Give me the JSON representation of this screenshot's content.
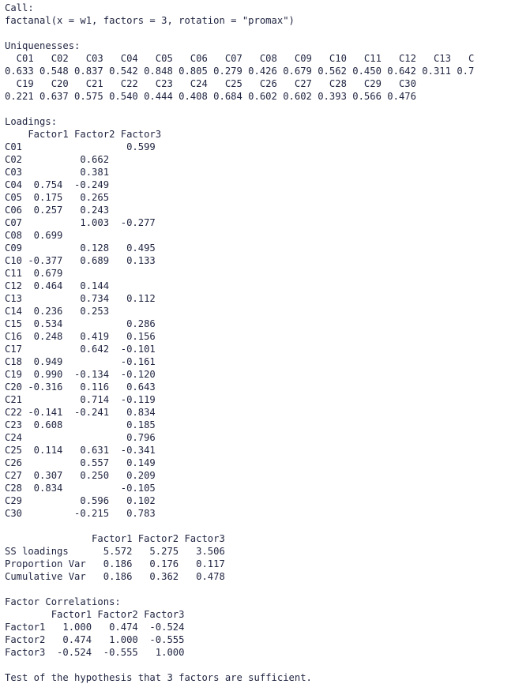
{
  "call": {
    "header": "Call:",
    "command": "factanal(x = w1, factors = 3, rotation = \"promax\")"
  },
  "uniquenesses": {
    "header": "Uniquenesses:",
    "lines": [
      "  C01   C02   C03   C04   C05   C06   C07   C08   C09   C10   C11   C12   C13   C",
      "0.633 0.548 0.837 0.542 0.848 0.805 0.279 0.426 0.679 0.562 0.450 0.642 0.311 0.7",
      "  C19   C20   C21   C22   C23   C24   C25   C26   C27   C28   C29   C30",
      "0.221 0.637 0.575 0.540 0.444 0.408 0.684 0.602 0.602 0.393 0.566 0.476"
    ]
  },
  "loadings": {
    "header": "Loadings:",
    "columns": "    Factor1 Factor2 Factor3",
    "rows": [
      "C01                  0.599 ",
      "C02          0.662         ",
      "C03          0.381         ",
      "C04  0.754  -0.249         ",
      "C05  0.175   0.265         ",
      "C06  0.257   0.243         ",
      "C07          1.003  -0.277 ",
      "C08  0.699                 ",
      "C09          0.128   0.495 ",
      "C10 -0.377   0.689   0.133 ",
      "C11  0.679                 ",
      "C12  0.464   0.144         ",
      "C13          0.734   0.112 ",
      "C14  0.236   0.253         ",
      "C15  0.534           0.286 ",
      "C16  0.248   0.419   0.156 ",
      "C17          0.642  -0.101 ",
      "C18  0.949          -0.161 ",
      "C19  0.990  -0.134  -0.120 ",
      "C20 -0.316   0.116   0.643 ",
      "C21          0.714  -0.119 ",
      "C22 -0.141  -0.241   0.834 ",
      "C23  0.608           0.185 ",
      "C24                  0.796 ",
      "C25  0.114   0.631  -0.341 ",
      "C26          0.557   0.149 ",
      "C27  0.307   0.250   0.209 ",
      "C28  0.834          -0.105 ",
      "C29          0.596   0.102 ",
      "C30         -0.215   0.783 "
    ]
  },
  "variance": {
    "columns": "               Factor1 Factor2 Factor3",
    "rows": [
      "SS loadings      5.572   5.275   3.506",
      "Proportion Var   0.186   0.176   0.117",
      "Cumulative Var   0.186   0.362   0.478"
    ]
  },
  "correlations": {
    "header": "Factor Correlations:",
    "columns": "        Factor1 Factor2 Factor3",
    "rows": [
      "Factor1   1.000   0.474  -0.524",
      "Factor2   0.474   1.000  -0.555",
      "Factor3  -0.524  -0.555   1.000"
    ]
  },
  "footer": "Test of the hypothesis that 3 factors are sufficient."
}
